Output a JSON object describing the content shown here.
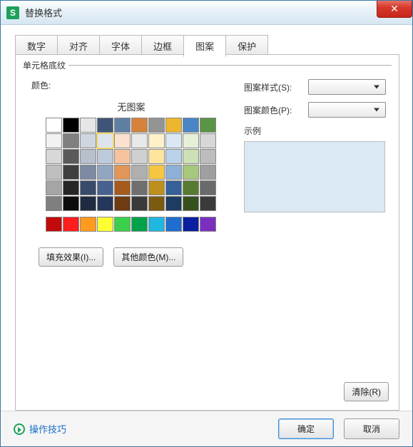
{
  "title": "替换格式",
  "title_icon_letter": "S",
  "close_glyph": "✕",
  "tabs": {
    "number": "数字",
    "align": "对齐",
    "font": "字体",
    "border": "边框",
    "pattern": "图案",
    "protect": "保护"
  },
  "group_label": "单元格底纹",
  "color_label": "颜色:",
  "no_pattern_label": "无图案",
  "palette_rows": [
    [
      "#ffffff",
      "#000000",
      "#e6e6e6",
      "#3f5578",
      "#5f7fa2",
      "#d6823a",
      "#949494",
      "#edb62e",
      "#4a86c6",
      "#5a9447"
    ],
    [
      "#f2f2f2",
      "#808080",
      "#cfd6df",
      "#dde4ee",
      "#fbe1cf",
      "#e9e9e9",
      "#fff2c9",
      "#dbe7f4",
      "#e6efd9",
      "#d7d7d7"
    ],
    [
      "#d8d8d8",
      "#5a5a5a",
      "#b7c0cd",
      "#bccada",
      "#f6c39e",
      "#d0d0d0",
      "#ffe59c",
      "#b9d2ea",
      "#cde0b6",
      "#bdbdbd"
    ],
    [
      "#bfbfbf",
      "#3f3f3f",
      "#7c8aa3",
      "#92a6c2",
      "#e29558",
      "#afafaf",
      "#f6c643",
      "#8db0d7",
      "#a6c77c",
      "#9f9f9f"
    ],
    [
      "#a5a5a5",
      "#262626",
      "#394b6b",
      "#476191",
      "#a65a1c",
      "#6f6f6f",
      "#bd8f1c",
      "#346198",
      "#577b30",
      "#6a6a6a"
    ],
    [
      "#7f7f7f",
      "#0c0c0c",
      "#1f2b40",
      "#24365a",
      "#6e3b12",
      "#3a3a3a",
      "#7b5b10",
      "#1e3b61",
      "#36501d",
      "#3a3a3a"
    ]
  ],
  "extra_row": [
    "#c20a0a",
    "#ff1e1e",
    "#ff9a1e",
    "#ffff33",
    "#3bcf4b",
    "#00a34a",
    "#1fb6e0",
    "#1f6ecf",
    "#0a1ea0",
    "#7a2fbf"
  ],
  "selected_swatch": {
    "row": 1,
    "col": 3
  },
  "buttons": {
    "fill_effect": "填充效果(I)...",
    "more_colors": "其他颜色(M)...",
    "clear": "清除(R)",
    "ok": "确定",
    "cancel": "取消"
  },
  "right": {
    "pattern_style_label": "图案样式(S):",
    "pattern_color_label": "图案颜色(P):",
    "example_label": "示例"
  },
  "example_color": "#dbe9f4",
  "tip_link": "操作技巧"
}
